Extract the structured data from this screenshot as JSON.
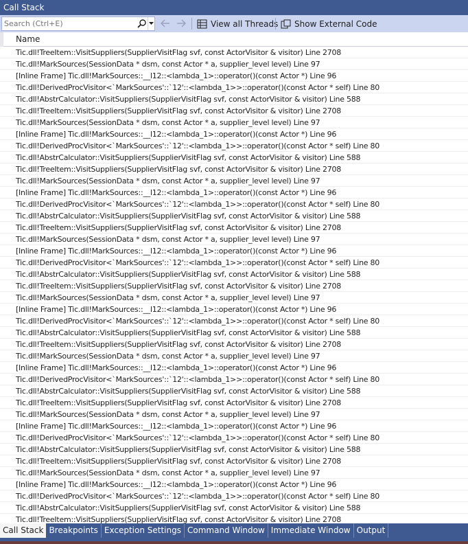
{
  "window": {
    "title": "Call Stack"
  },
  "toolbar": {
    "search_placeholder": "Search (Ctrl+E)",
    "view_all_threads": "View all Threads",
    "show_external_code": "Show External Code"
  },
  "list": {
    "column_name": "Name",
    "frames": [
      "Tic.dll!TreeItem::VisitSuppliers(SupplierVisitFlag svf, const ActorVisitor & visitor) Line 2708",
      "Tic.dll!MarkSources(SessionData * dsm, const Actor * a, supplier_level level) Line 97",
      "[Inline Frame] Tic.dll!MarkSources::__l12::<lambda_1>::operator()(const Actor *) Line 96",
      "Tic.dll!DerivedProcVisitor<`MarkSources'::`12'::<lambda_1>>::operator()(const Actor * self) Line 80",
      "Tic.dll!AbstrCalculator::VisitSuppliers(SupplierVisitFlag svf, const ActorVisitor & visitor) Line 588",
      "Tic.dll!TreeItem::VisitSuppliers(SupplierVisitFlag svf, const ActorVisitor & visitor) Line 2708",
      "Tic.dll!MarkSources(SessionData * dsm, const Actor * a, supplier_level level) Line 97",
      "[Inline Frame] Tic.dll!MarkSources::__l12::<lambda_1>::operator()(const Actor *) Line 96",
      "Tic.dll!DerivedProcVisitor<`MarkSources'::`12'::<lambda_1>>::operator()(const Actor * self) Line 80",
      "Tic.dll!AbstrCalculator::VisitSuppliers(SupplierVisitFlag svf, const ActorVisitor & visitor) Line 588",
      "Tic.dll!TreeItem::VisitSuppliers(SupplierVisitFlag svf, const ActorVisitor & visitor) Line 2708",
      "Tic.dll!MarkSources(SessionData * dsm, const Actor * a, supplier_level level) Line 97",
      "[Inline Frame] Tic.dll!MarkSources::__l12::<lambda_1>::operator()(const Actor *) Line 96",
      "Tic.dll!DerivedProcVisitor<`MarkSources'::`12'::<lambda_1>>::operator()(const Actor * self) Line 80",
      "Tic.dll!AbstrCalculator::VisitSuppliers(SupplierVisitFlag svf, const ActorVisitor & visitor) Line 588",
      "Tic.dll!TreeItem::VisitSuppliers(SupplierVisitFlag svf, const ActorVisitor & visitor) Line 2708",
      "Tic.dll!MarkSources(SessionData * dsm, const Actor * a, supplier_level level) Line 97",
      "[Inline Frame] Tic.dll!MarkSources::__l12::<lambda_1>::operator()(const Actor *) Line 96",
      "Tic.dll!DerivedProcVisitor<`MarkSources'::`12'::<lambda_1>>::operator()(const Actor * self) Line 80",
      "Tic.dll!AbstrCalculator::VisitSuppliers(SupplierVisitFlag svf, const ActorVisitor & visitor) Line 588",
      "Tic.dll!TreeItem::VisitSuppliers(SupplierVisitFlag svf, const ActorVisitor & visitor) Line 2708",
      "Tic.dll!MarkSources(SessionData * dsm, const Actor * a, supplier_level level) Line 97",
      "[Inline Frame] Tic.dll!MarkSources::__l12::<lambda_1>::operator()(const Actor *) Line 96",
      "Tic.dll!DerivedProcVisitor<`MarkSources'::`12'::<lambda_1>>::operator()(const Actor * self) Line 80",
      "Tic.dll!AbstrCalculator::VisitSuppliers(SupplierVisitFlag svf, const ActorVisitor & visitor) Line 588",
      "Tic.dll!TreeItem::VisitSuppliers(SupplierVisitFlag svf, const ActorVisitor & visitor) Line 2708",
      "Tic.dll!MarkSources(SessionData * dsm, const Actor * a, supplier_level level) Line 97",
      "[Inline Frame] Tic.dll!MarkSources::__l12::<lambda_1>::operator()(const Actor *) Line 96",
      "Tic.dll!DerivedProcVisitor<`MarkSources'::`12'::<lambda_1>>::operator()(const Actor * self) Line 80",
      "Tic.dll!AbstrCalculator::VisitSuppliers(SupplierVisitFlag svf, const ActorVisitor & visitor) Line 588",
      "Tic.dll!TreeItem::VisitSuppliers(SupplierVisitFlag svf, const ActorVisitor & visitor) Line 2708",
      "Tic.dll!MarkSources(SessionData * dsm, const Actor * a, supplier_level level) Line 97",
      "[Inline Frame] Tic.dll!MarkSources::__l12::<lambda_1>::operator()(const Actor *) Line 96",
      "Tic.dll!DerivedProcVisitor<`MarkSources'::`12'::<lambda_1>>::operator()(const Actor * self) Line 80",
      "Tic.dll!AbstrCalculator::VisitSuppliers(SupplierVisitFlag svf, const ActorVisitor & visitor) Line 588",
      "Tic.dll!TreeItem::VisitSuppliers(SupplierVisitFlag svf, const ActorVisitor & visitor) Line 2708",
      "Tic.dll!MarkSources(SessionData * dsm, const Actor * a, supplier_level level) Line 97",
      "[Inline Frame] Tic.dll!MarkSources::__l12::<lambda_1>::operator()(const Actor *) Line 96",
      "Tic.dll!DerivedProcVisitor<`MarkSources'::`12'::<lambda_1>>::operator()(const Actor * self) Line 80",
      "Tic.dll!AbstrCalculator::VisitSuppliers(SupplierVisitFlag svf, const ActorVisitor & visitor) Line 588",
      "Tic.dll!TreeItem::VisitSuppliers(SupplierVisitFlag svf, const ActorVisitor & visitor) Line 2708"
    ]
  },
  "tabs": [
    {
      "label": "Call Stack",
      "active": true
    },
    {
      "label": "Breakpoints",
      "active": false
    },
    {
      "label": "Exception Settings",
      "active": false
    },
    {
      "label": "Command Window",
      "active": false
    },
    {
      "label": "Immediate Window",
      "active": false
    },
    {
      "label": "Output",
      "active": false
    }
  ],
  "icons": {
    "search": "search-icon",
    "dropdown": "chevron-down-icon",
    "back": "arrow-left-icon",
    "forward": "arrow-right-icon",
    "threads": "threads-grid-icon",
    "external_code": "external-code-icon"
  },
  "colors": {
    "title_bar": "#3f5991",
    "toolbar": "#ccd5f0",
    "active_tab": "#f5f5f5"
  }
}
